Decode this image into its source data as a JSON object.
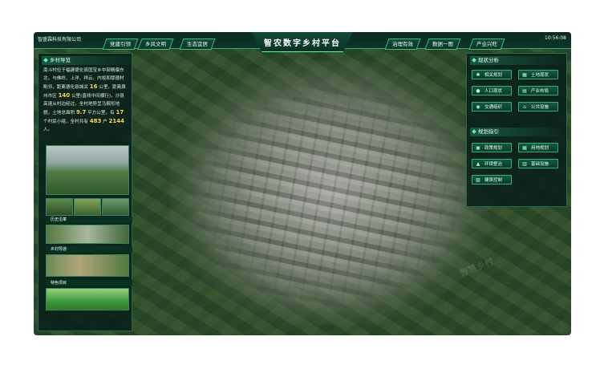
{
  "header": {
    "company": "智盛霖科技有限公司",
    "title": "智农数字乡村平台",
    "time": "10:56:08",
    "nav_left": [
      "党建引领",
      "乡风文明",
      "生态宜居"
    ],
    "nav_right": [
      "治理有效",
      "数据一图",
      "产业兴旺"
    ]
  },
  "left_panel": {
    "section_title": "乡村导览",
    "intro_parts": [
      "南斗村位于福建德化县国宝乡中部略偏东北，与佛岭、上洋、祥云、内坂和厚德村毗邻，距离德化县城关 ",
      "16",
      " 公里，距离泉州市区 ",
      "140",
      " 公里(直线中间横行)，沙县高速从村边经过，全村地势呈马鞍形地貌，土地总面积 ",
      "9.7",
      " 平方公里，有 ",
      "17",
      " 个村民小组，全村共有 ",
      "483",
      " 户 ",
      "2144",
      " 人。"
    ],
    "captions": [
      "历史沿革",
      "乡村导游",
      "特色项目"
    ]
  },
  "right_panel": {
    "section1_title": "现状分析",
    "section1_buttons": [
      {
        "label": "相关规划",
        "icon": "wrench-icon"
      },
      {
        "label": "土地现状",
        "icon": "land-icon"
      },
      {
        "label": "人口现状",
        "icon": "people-icon"
      },
      {
        "label": "产业布局",
        "icon": "industry-icon"
      },
      {
        "label": "交通组织",
        "icon": "traffic-icon"
      },
      {
        "label": "公共设施",
        "icon": "facility-icon"
      }
    ],
    "section2_title": "规划指引",
    "section2_buttons": [
      {
        "label": "政策规划",
        "icon": "policy-icon"
      },
      {
        "label": "用地规划",
        "icon": "land-plan-icon"
      },
      {
        "label": "环境整治",
        "icon": "environment-icon"
      },
      {
        "label": "基础设施",
        "icon": "infrastructure-icon"
      },
      {
        "label": "建筑控制",
        "icon": "building-icon"
      }
    ]
  },
  "watermark": "智慧乡村"
}
